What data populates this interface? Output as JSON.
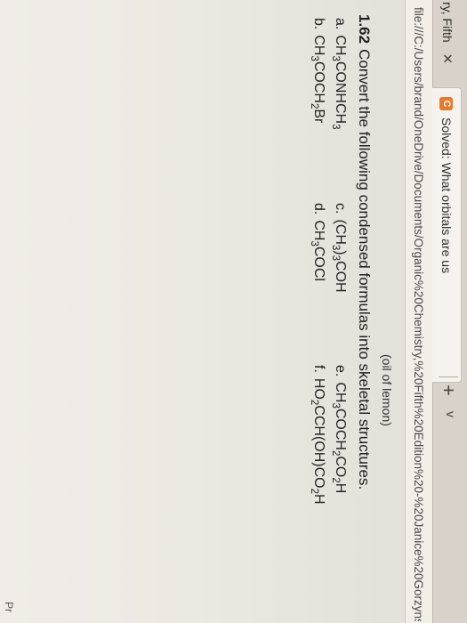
{
  "browser": {
    "tabs": [
      {
        "title": "ry, Fifth",
        "close": "✕"
      },
      {
        "favicon": "C",
        "title": "Solved: What orbitals are us",
        "close": "✕"
      }
    ],
    "new_tab": "+",
    "tab_menu": "v",
    "url": "file:///C:/Users/brand/OneDrive/Documents/Organic%20Chemistry,%20Fifth%20Edition%20-%20Janice%20Gorzynski%20Smith"
  },
  "document": {
    "caption": "(oil of lemon)",
    "problem_number": "1.62",
    "problem_text": "Convert the following condensed formulas into skeletal structures.",
    "items": [
      {
        "letter": "a.",
        "formula": "CH<sub>3</sub>CONHCH<sub>3</sub>"
      },
      {
        "letter": "b.",
        "formula": "CH<sub>3</sub>COCH<sub>2</sub>Br"
      },
      {
        "letter": "c.",
        "formula": "(CH<sub>3</sub>)<sub>3</sub>COH"
      },
      {
        "letter": "d.",
        "formula": "CH<sub>3</sub>COCl"
      },
      {
        "letter": "e.",
        "formula": "CH<sub>3</sub>COCH<sub>2</sub>CO<sub>2</sub>H"
      },
      {
        "letter": "f.",
        "formula": "HO<sub>2</sub>CCH(OH)CO<sub>2</sub>H"
      }
    ],
    "corner_text": "Pr"
  }
}
